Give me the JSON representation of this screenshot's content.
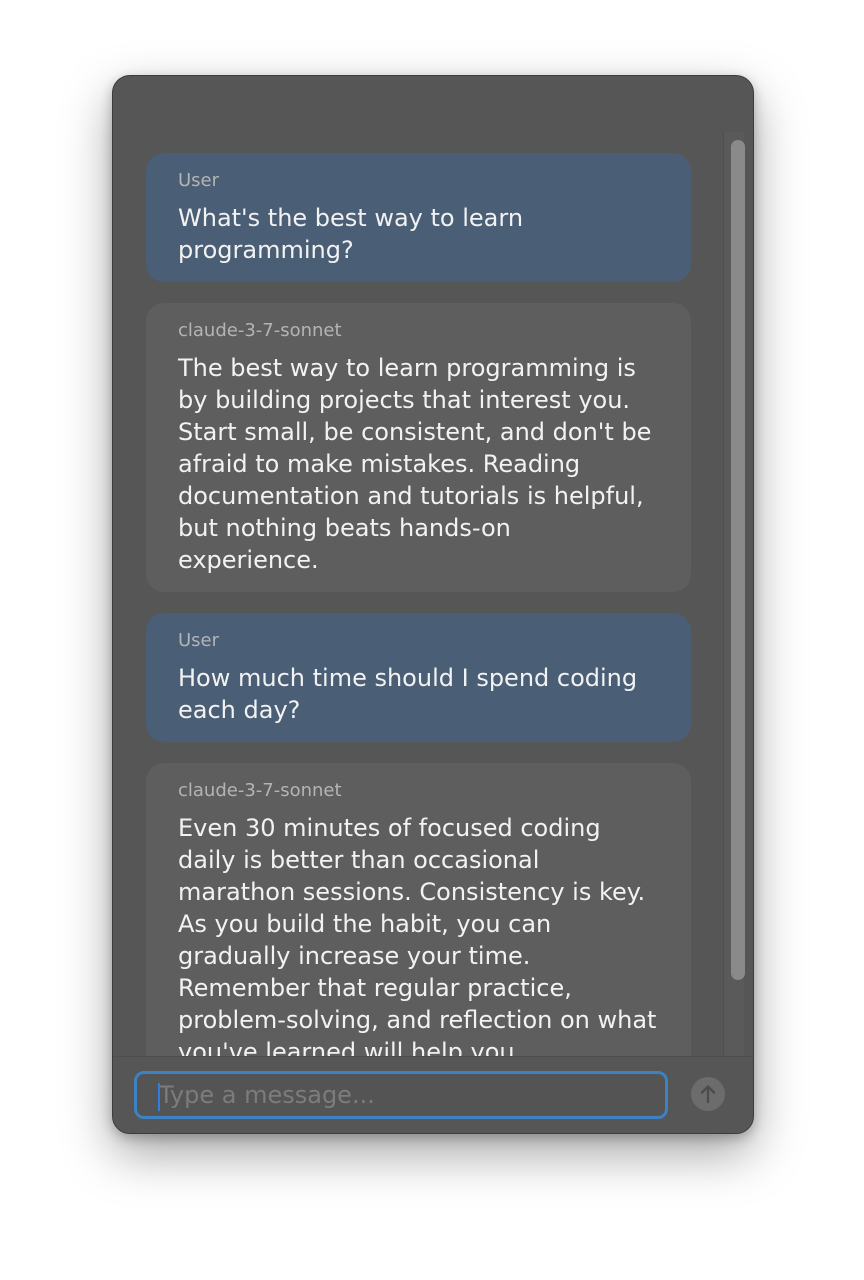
{
  "messages": [
    {
      "role": "User",
      "text": "What's the best way to learn programming?"
    },
    {
      "role": "claude-3-7-sonnet",
      "text": "The best way to learn programming is by building projects that interest you. Start small, be consistent, and don't be afraid to make mistakes. Reading documentation and tutorials is helpful, but nothing beats hands-on experience."
    },
    {
      "role": "User",
      "text": "How much time should I spend coding each day?"
    },
    {
      "role": "claude-3-7-sonnet",
      "text": "Even 30 minutes of focused coding daily is better than occasional marathon sessions. Consistency is key. As you build the habit, you can gradually increase your time. Remember that regular practice, problem-solving, and reflection on what you've learned will help you"
    }
  ],
  "composer": {
    "placeholder": "Type a message...",
    "value": "",
    "send_icon": "arrow-up-icon"
  },
  "colors": {
    "window_bg": "#565656",
    "user_bubble": "#4a5e76",
    "assistant_bubble": "#5e5e5e",
    "focus_ring": "#3d82c2"
  }
}
